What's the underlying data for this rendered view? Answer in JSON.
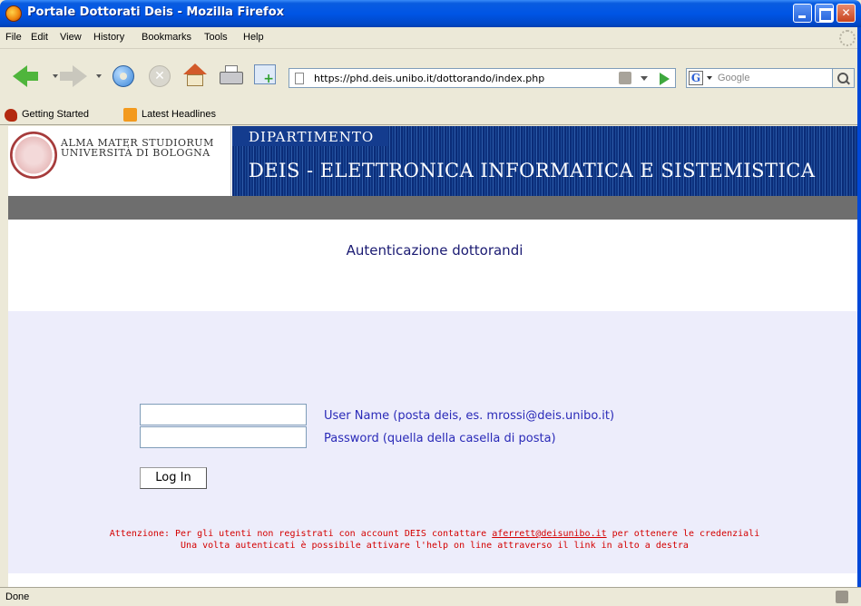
{
  "window": {
    "title": "Portale Dottorati Deis - Mozilla Firefox",
    "min_glyph": "",
    "max_glyph": "",
    "close_glyph": "✕"
  },
  "menu": {
    "items": [
      "File",
      "Edit",
      "View",
      "History",
      "Bookmarks",
      "Tools",
      "Help"
    ]
  },
  "navbar": {
    "url": "https://phd.deis.unibo.it/dottorando/index.php",
    "search_placeholder": "Google",
    "search_engine_glyph": "G",
    "stop_glyph": "✕"
  },
  "bookmarks": {
    "items": [
      "Getting Started",
      "Latest Headlines"
    ]
  },
  "header": {
    "university_line1": "ALMA MATER STUDIORUM",
    "university_line2": "UNIVERSITÀ DI BOLOGNA",
    "dipartimento": "DIPARTIMENTO",
    "deis_title": "DEIS - ELETTRONICA INFORMATICA E SISTEMISTICA"
  },
  "page": {
    "heading": "Autenticazione dottorandi",
    "username_label": "User Name (posta deis, es. mrossi@deis.unibo.it)",
    "password_label": "Password (quella della casella di posta)",
    "username_value": "",
    "password_value": "",
    "login_button": "Log In",
    "warning_prefix": "Attenzione: Per gli utenti non registrati con account DEIS contattare ",
    "warning_email": "aferrett@deisunibo.it",
    "warning_suffix": " per ottenere le credenziali",
    "warning_line2": "Una volta autenticati è possibile attivare l'help on line attraverso il link in alto a destra"
  },
  "status": {
    "text": "Done"
  }
}
